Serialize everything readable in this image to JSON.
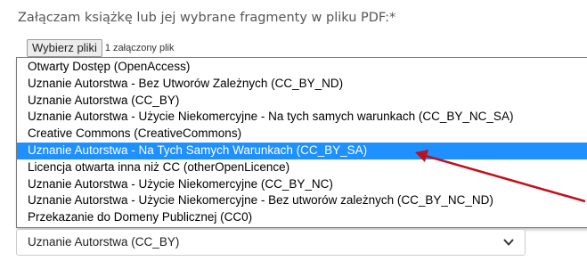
{
  "form": {
    "prompt": "Załączam książkę lub jej wybrane fragmenty w pliku PDF:*",
    "file_button": "Wybierz pliki",
    "file_status": "1 załączony plik"
  },
  "license_dropdown": {
    "options": [
      "Otwarty Dostęp (OpenAccess)",
      "Uznanie Autorstwa - Bez Utworów Zależnych (CC_BY_ND)",
      "Uznanie Autorstwa (CC_BY)",
      "Uznanie Autorstwa - Użycie Niekomercyjne - Na tych samych warunkach (CC_BY_NC_SA)",
      "Creative Commons (CreativeCommons)",
      "Uznanie Autorstwa - Na Tych Samych Warunkach (CC_BY_SA)",
      "Licencja otwarta inna niż CC (otherOpenLicence)",
      "Uznanie Autorstwa - Użycie Niekomercyjne (CC_BY_NC)",
      "Uznanie Autorstwa - Użycie Niekomercyjne - Bez utworów zależnych (CC_BY_NC_ND)",
      "Przekazanie do Domeny Publicznej (CC0)"
    ],
    "highlighted_index": 5,
    "highlight_color": "#1e90ff",
    "selected_value": "Uznanie Autorstwa (CC_BY)",
    "chevron_icon": "chevron-down-icon"
  },
  "annotation": {
    "arrow_color": "#c0101a"
  }
}
